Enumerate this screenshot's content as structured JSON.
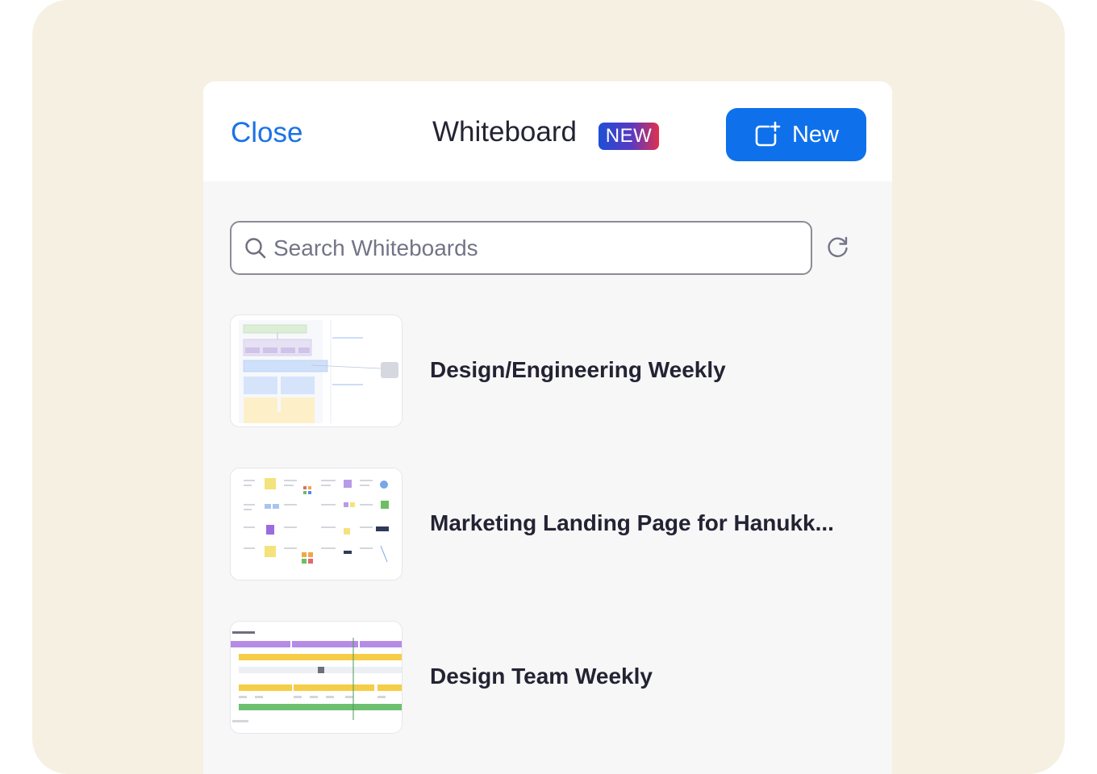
{
  "header": {
    "close_label": "Close",
    "title": "Whiteboard",
    "badge": "NEW",
    "new_button_label": "New"
  },
  "search": {
    "placeholder": "Search Whiteboards",
    "value": ""
  },
  "whiteboards": [
    {
      "name": "Design/Engineering Weekly"
    },
    {
      "name": "Marketing Landing Page for Hanukk..."
    },
    {
      "name": "Design Team Weekly"
    }
  ],
  "colors": {
    "accent": "#0e71eb",
    "link": "#1a72e6",
    "backdrop": "#f6f0e3",
    "badge_gradient": [
      "#1e4fd6",
      "#e0304e"
    ]
  },
  "icons": [
    "add-board-icon",
    "search-icon",
    "refresh-icon"
  ]
}
